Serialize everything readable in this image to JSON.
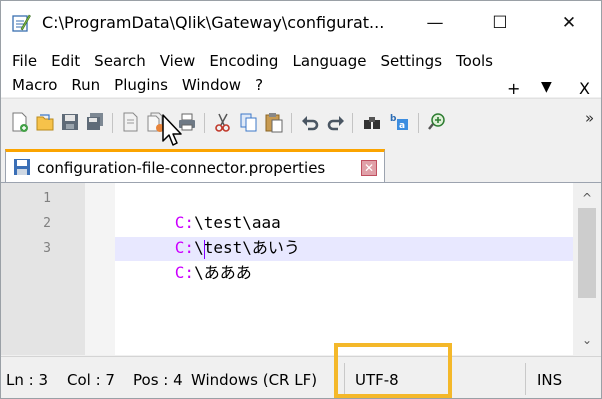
{
  "window": {
    "title": "C:\\ProgramData\\Qlik\\Gateway\\configurat...",
    "minimize_label": "—",
    "maximize_label": "☐",
    "close_label": "✕"
  },
  "menu": {
    "row1": [
      "File",
      "Edit",
      "Search",
      "View",
      "Encoding",
      "Language",
      "Settings",
      "Tools"
    ],
    "row2": [
      "Macro",
      "Run",
      "Plugins",
      "Window",
      "?"
    ],
    "extras": {
      "plus": "+",
      "dropdown": "▼",
      "close": "X"
    }
  },
  "toolbar": {
    "icons": [
      "new-file-icon",
      "open-file-icon",
      "save-icon",
      "save-all-icon",
      "close-icon",
      "close-all-icon",
      "print-icon",
      "cut-icon",
      "copy-icon",
      "paste-icon",
      "undo-icon",
      "redo-icon",
      "find-icon",
      "replace-icon",
      "zoom-in-icon"
    ],
    "more_label": "»"
  },
  "tab": {
    "label": "configuration-file-connector.properties",
    "close_label": "✕"
  },
  "editor": {
    "lines": [
      {
        "number": "1",
        "drive": "C:",
        "rest": "\\test\\aaa"
      },
      {
        "number": "2",
        "drive": "C:",
        "rest": "\\test\\あいう"
      },
      {
        "number": "3",
        "drive": "C:",
        "rest": "\\あああ"
      }
    ]
  },
  "status": {
    "line": "Ln : 3",
    "col": "Col : 7",
    "pos": "Pos : 4",
    "eol": "Windows (CR LF)",
    "encoding": "UTF-8",
    "mode": "INS"
  },
  "colors": {
    "highlight": "#f4b82a",
    "tab_accent": "#fba400",
    "drive_letter": "#cc00ff"
  }
}
